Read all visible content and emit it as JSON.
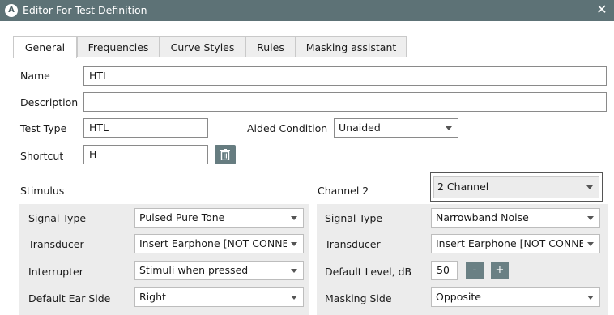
{
  "window": {
    "title": "Editor For Test Definition",
    "app_badge": "A",
    "close_glyph": "✕"
  },
  "tabs": [
    "General",
    "Frequencies",
    "Curve Styles",
    "Rules",
    "Masking assistant"
  ],
  "form": {
    "name_label": "Name",
    "name_value": "HTL",
    "description_label": "Description",
    "description_value": "",
    "test_type_label": "Test Type",
    "test_type_value": "HTL",
    "aided_label": "Aided Condition",
    "aided_value": "Unaided",
    "shortcut_label": "Shortcut",
    "shortcut_value": "H"
  },
  "stimulus": {
    "title": "Stimulus",
    "signal_type_label": "Signal Type",
    "signal_type_value": "Pulsed Pure Tone",
    "transducer_label": "Transducer",
    "transducer_value": "Insert Earphone [NOT CONNECTED]",
    "interrupter_label": "Interrupter",
    "interrupter_value": "Stimuli when pressed",
    "ear_side_label": "Default Ear Side",
    "ear_side_value": "Right"
  },
  "channel2": {
    "title": "Channel 2",
    "mode_value": "2 Channel",
    "signal_type_label": "Signal Type",
    "signal_type_value": "Narrowband Noise",
    "transducer_label": "Transducer",
    "transducer_value": "Insert Earphone [NOT CONNECTED]",
    "level_label": "Default Level, dB",
    "level_value": "50",
    "minus": "-",
    "plus": "+",
    "masking_side_label": "Masking Side",
    "masking_side_value": "Opposite"
  },
  "icons": {
    "app": "app-badge-icon",
    "close": "close-icon",
    "delete": "trash-icon",
    "dropdown": "chevron-down-icon"
  },
  "colors": {
    "titlebar": "#5d7276",
    "button": "#667c80",
    "panel": "#ececec"
  }
}
